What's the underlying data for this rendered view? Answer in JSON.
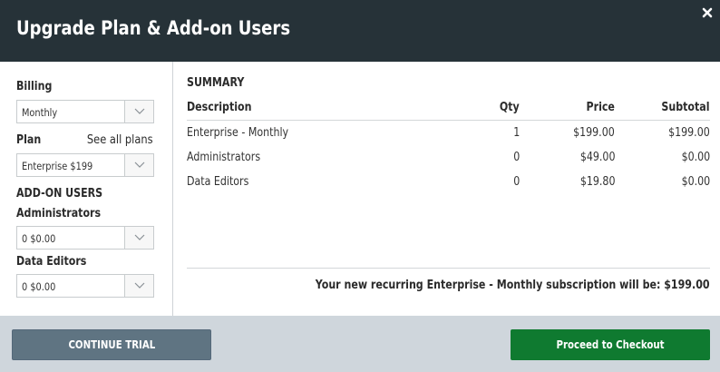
{
  "dialog": {
    "title": "Upgrade Plan & Add-on Users"
  },
  "billing": {
    "label": "Billing",
    "selected": "Monthly"
  },
  "plan": {
    "label": "Plan",
    "see_all_link": "See all plans",
    "selected": "Enterprise $199"
  },
  "addons": {
    "heading": "ADD-ON USERS",
    "administrators": {
      "label": "Administrators",
      "selected": "0 $0.00"
    },
    "data_editors": {
      "label": "Data Editors",
      "selected": "0 $0.00"
    }
  },
  "summary": {
    "title": "SUMMARY",
    "columns": [
      "Description",
      "Qty",
      "Price",
      "Subtotal"
    ],
    "rows": [
      [
        "Enterprise - Monthly",
        "1",
        "$199.00",
        "$199.00"
      ],
      [
        "Administrators",
        "0",
        "$49.00",
        "$0.00"
      ],
      [
        "Data Editors",
        "0",
        "$19.80",
        "$0.00"
      ]
    ],
    "total_text": "Your new recurring Enterprise - Monthly subscription will be: $199.00"
  },
  "footer": {
    "continue_trial_label": "CONTINUE TRIAL",
    "checkout_label": "Proceed to Checkout"
  },
  "colors": {
    "header_bg": "#263238",
    "footer_bg": "#cfd6dc",
    "trial_button": "#5f7482",
    "checkout_button": "#0f7a30"
  },
  "icons": {
    "close": "close-icon",
    "dropdown": "chevron-down-icon"
  }
}
